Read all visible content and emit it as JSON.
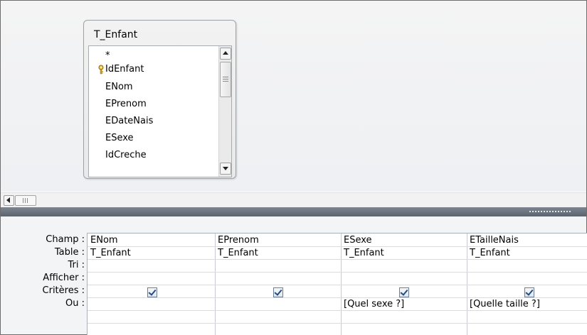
{
  "table_box": {
    "title": "T_Enfant",
    "fields": [
      "*",
      "IdEnfant",
      "ENom",
      "EPrenom",
      "EDateNais",
      "ESexe",
      "IdCreche"
    ],
    "primary_key_field": "IdEnfant"
  },
  "grid": {
    "row_labels": [
      "Champ :",
      "Table :",
      "Tri :",
      "Afficher :",
      "Critères :",
      "Ou :"
    ],
    "columns": [
      {
        "champ": "ENom",
        "table": "T_Enfant",
        "tri": "",
        "afficher": true,
        "criteres": "",
        "ou": ""
      },
      {
        "champ": "EPrenom",
        "table": "T_Enfant",
        "tri": "",
        "afficher": true,
        "criteres": "",
        "ou": ""
      },
      {
        "champ": "ESexe",
        "table": "T_Enfant",
        "tri": "",
        "afficher": true,
        "criteres": "[Quel sexe ?]",
        "ou": ""
      },
      {
        "champ": "ETailleNais",
        "table": "T_Enfant",
        "tri": "",
        "afficher": true,
        "criteres": "[Quelle taille ?]",
        "ou": ""
      }
    ]
  },
  "icons": {
    "key": "key-icon",
    "scroll_up": "arrow-up-icon",
    "scroll_down": "arrow-down-icon",
    "scroll_left": "arrow-left-icon",
    "checkbox": "checkbox-checked-icon"
  }
}
